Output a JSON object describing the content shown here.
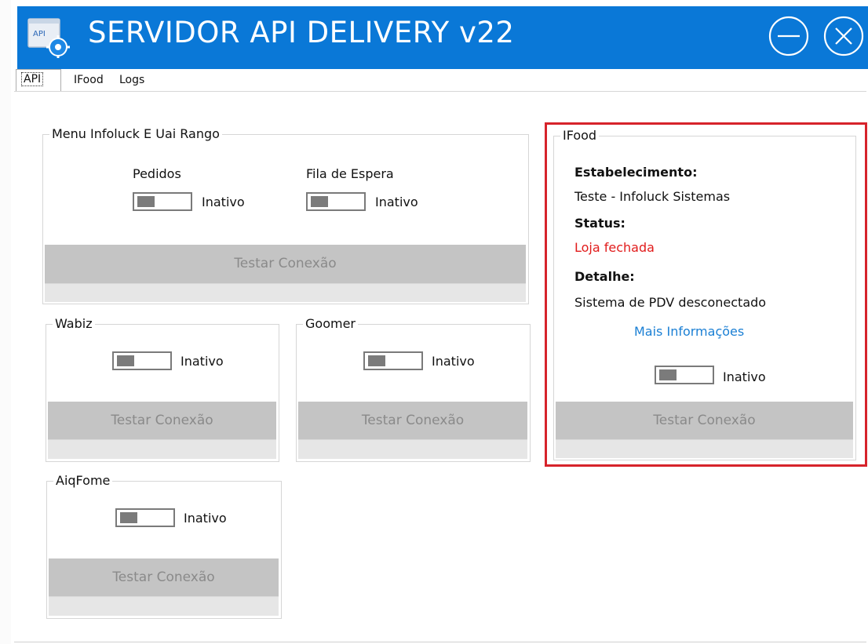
{
  "window": {
    "title": "SERVIDOR API DELIVERY v22",
    "icon_text": "API",
    "icons": {
      "app": "api-gear-icon",
      "minimize": "minimize-icon",
      "close": "close-icon"
    },
    "colors": {
      "titlebar": "#0a78d7",
      "highlight": "#d6232b",
      "status_red": "#e11b1b",
      "link": "#1a7fd4"
    }
  },
  "tabs": [
    {
      "label": "API",
      "active": true
    },
    {
      "label": "IFood",
      "active": false
    },
    {
      "label": "Logs",
      "active": false
    }
  ],
  "panels": {
    "menu": {
      "title": "Menu Infoluck E Uai Rango",
      "pedidos_label": "Pedidos",
      "pedidos_status": "Inativo",
      "fila_label": "Fila de Espera",
      "fila_status": "Inativo",
      "test_button": "Testar Conexão"
    },
    "wabiz": {
      "title": "Wabiz",
      "status": "Inativo",
      "test_button": "Testar Conexão"
    },
    "goomer": {
      "title": "Goomer",
      "status": "Inativo",
      "test_button": "Testar Conexão"
    },
    "aiqfome": {
      "title": "AiqFome",
      "status": "Inativo",
      "test_button": "Testar Conexão"
    },
    "ifood": {
      "title": "IFood",
      "estabelecimento_label": "Estabelecimento:",
      "estabelecimento_value": "Teste - Infoluck Sistemas",
      "status_label": "Status:",
      "status_value": "Loja fechada",
      "detalhe_label": "Detalhe:",
      "detalhe_value": "Sistema de PDV desconectado",
      "more_info_link": "Mais Informações",
      "toggle_status": "Inativo",
      "test_button": "Testar Conexão"
    }
  }
}
